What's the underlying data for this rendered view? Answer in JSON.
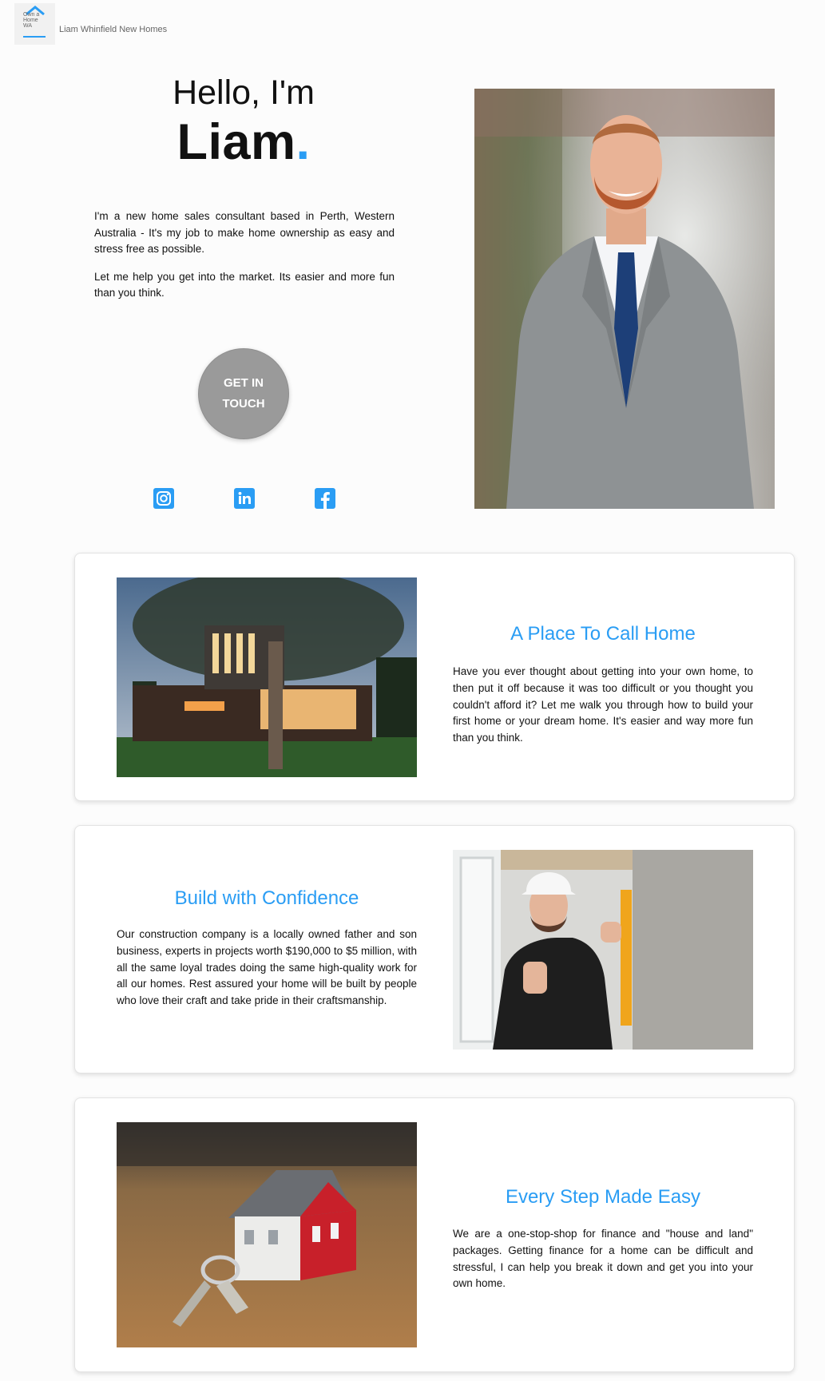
{
  "header": {
    "logo_lines": [
      "Own a",
      "Home",
      "WA"
    ],
    "site_name": "Liam Whinfield New Homes"
  },
  "hero": {
    "greeting": "Hello, I'm",
    "name": "Liam",
    "name_dot": ".",
    "intro_paragraphs": [
      "I'm a new home sales consultant based in Perth, Western Australia - It's my job to make home ownership as easy and stress free as possible.",
      "Let me help you get into the market. Its easier and more fun than you think."
    ],
    "cta_label": "GET IN TOUCH",
    "social_icons": [
      "instagram-icon",
      "linkedin-icon",
      "facebook-icon"
    ],
    "photo_alt": "Liam portrait photo"
  },
  "sections": [
    {
      "title": "A Place To Call Home",
      "text": "Have you ever thought about getting into your own home, to then put it off because it was too difficult or you thought you couldn't afford it? Let me walk you through how to build your first home or your dream home. It's easier and way more fun than you think."
    },
    {
      "title": "Build with Confidence",
      "text": "Our construction company is a locally owned father and son business, experts in projects worth $190,000 to $5 million, with all the same loyal trades doing the same high-quality work for all our homes. Rest assured your home will be built by people who love their craft and take pride in their craftsmanship."
    },
    {
      "title": "Every Step Made Easy",
      "text": "We are a one-stop-shop for finance and \"house and land\" packages. Getting finance for a home can be difficult and stressful, I can help you break it down and get you into your own home."
    }
  ],
  "colors": {
    "accent": "#2a9df4",
    "cta_bg": "#9a9a9a",
    "page_bg": "#fcfcfc"
  }
}
